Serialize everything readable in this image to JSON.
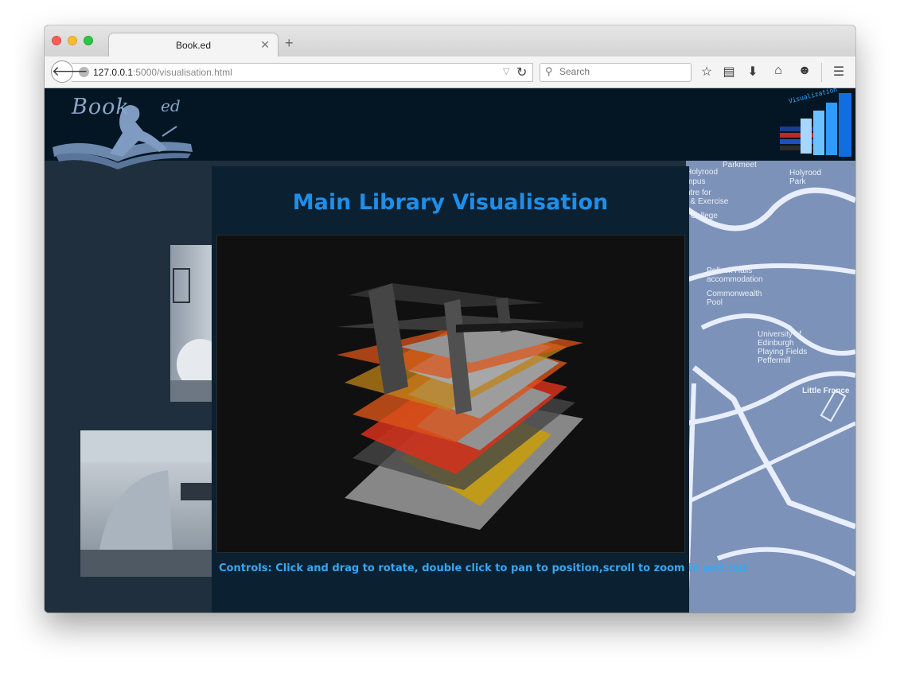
{
  "tab": {
    "title": "Book.ed"
  },
  "nav": {
    "url_host": "127.0.0.1",
    "url_rest": ":5000/visualisation.html",
    "search_placeholder": "Search"
  },
  "header": {
    "logo_left": "Book",
    "logo_right": "ed",
    "viz_label": "Visualization"
  },
  "map_labels": [
    "Parkmeet",
    "Holyrood",
    "mpus",
    "ntre for",
    "t & Exercise",
    "College",
    "Holyrood Park",
    "Pollock Halls accommodation",
    "Commonwealth Pool",
    "University of Edinburgh Playing Fields Peffermill",
    "Little France"
  ],
  "main": {
    "title": "Main Library Visualisation",
    "controls": "Controls: Click and drag to rotate, double click to pan to position,scroll to zoom in and out"
  },
  "colors": {
    "header_bg": "#041623",
    "panel_bg": "#0b2132",
    "title_blue": "#1f8ee8",
    "floor_orange": "#e5581a",
    "floor_red": "#e2321c",
    "floor_yellow": "#c9a31a"
  }
}
